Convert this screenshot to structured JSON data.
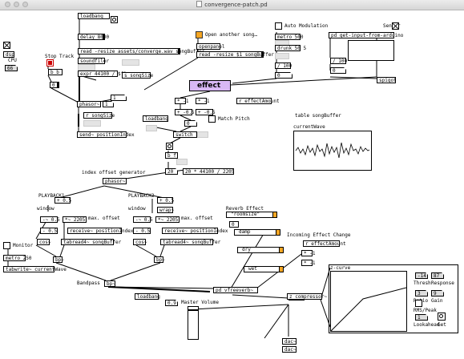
{
  "window": {
    "title": "convergence-patch.pd"
  },
  "objects": {
    "loadbang_top": "loadbang",
    "delay": "delay 8000",
    "read_converge": "read -resize assets/converge.wav songBuffer",
    "soundfiler": "soundfiler",
    "expr": "expr 44100 / $f1",
    "s_songsize": "s songSize",
    "openpanel": "openpanel",
    "open_another": "Open another song…",
    "read_any": "read -resize $1 songBuffer",
    "auto_mod": "Auto Modulation",
    "metro500": "metro 500",
    "drunk": "drunk 50 5",
    "div100": "/ 100",
    "sensor": "Sensor",
    "pd_arduino": "pd get-input-from-arduino",
    "div_small": "/ 100",
    "spigot": "spigot",
    "dsp": "dsp",
    "cpu": "CPU",
    "cpu_val": "66",
    "stop_track": "Stop Track",
    "bb": "b b",
    "zero": "0",
    "phasor_top": "phasor~",
    "num1": "1",
    "songsize_recv": "r songSize",
    "send_position": "send~ positionIndex",
    "effect": "effect",
    "effect_amount": "r effectAmount",
    "times_neg1": "* -1",
    "plus_neg05": "+ -0.5",
    "times_neg1b": "* -1",
    "plus_neg05b": "+ -0.5",
    "loadbang_mid": "loadbang",
    "match_pitch": "Match Pitch",
    "switch2": "switch 2",
    "bf": "b f",
    "twenty": "20",
    "twenty_expr": "20 * 44100 / 2205",
    "table_song": "table songBuffer",
    "current_wave": "currentWave",
    "index_offset": "index offset generator",
    "phasor_mid": "phasor~",
    "playback1": "PLAYBACK1",
    "playback2": "PLAYBACK2",
    "window": "window",
    "plus05": "+ 0.5",
    "wrap": "wrap~",
    "minus05": "-~ 0.5",
    "times2205": "*~ 2205",
    "max_offset": "max. offset",
    "receive_pos": "receive~ positionIndex",
    "cos": "cos~",
    "tabread4": "tabread4~ songBuffer",
    "monitor": "Monitor",
    "metro250": "metro 250",
    "tabwrite": "tabwrite~ currentWave",
    "bandpass": "Bandpass",
    "bp": "bp~",
    "reverb_effect": "Reverb Effect",
    "roomsize": "\"roomsize\"",
    "damp": "damp",
    "dry": "dry",
    "wet": "wet",
    "incoming_effect": "Incoming Effect Change",
    "effect_amount2": "r effectAmount",
    "pd_vfreeverb": "pd vfreeverb~",
    "loadbang_bottom": "loadbang",
    "master_val": "0.9",
    "master_volume": "Master Volume",
    "compressor": "z_compressor~",
    "z_curve": "z-curve",
    "thresh_val": "-14",
    "response_val": "87",
    "thresh": "Thresh",
    "response": "Response",
    "ratio_val": "3",
    "gain_val": "9",
    "ratio": "Ratio",
    "gain": "Gain",
    "rms_peak": "RMS/Peak",
    "lookahead_val": "1",
    "lookahead": "Lookahead",
    "get": "Get",
    "dac": "dac~",
    "dac_small": "dac~",
    "minus_small": "- 0.5"
  },
  "colors": {
    "effect_bg": "#d8b8f5",
    "slider_knob": "#f5a623",
    "toggle_on": "#f5a623",
    "stop_red": "#cc0000"
  }
}
